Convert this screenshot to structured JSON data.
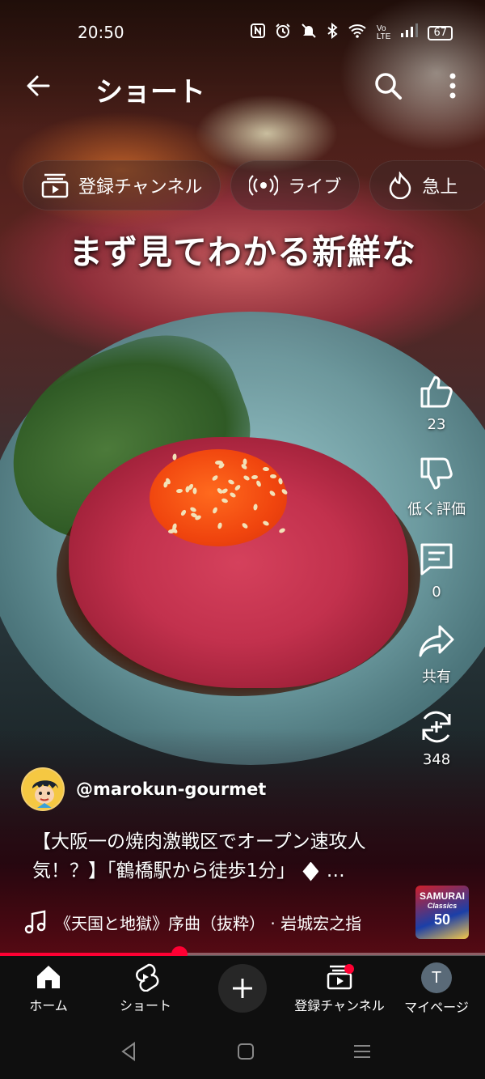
{
  "status_bar": {
    "time": "20:50",
    "battery": "67"
  },
  "app_bar": {
    "title": "ショート"
  },
  "chips": [
    {
      "label": "登録チャンネル",
      "icon": "subscriptions-icon"
    },
    {
      "label": "ライブ",
      "icon": "live-icon"
    },
    {
      "label": "急上",
      "icon": "trending-icon"
    }
  ],
  "video": {
    "overlay_caption": "まず見てわかる新鮮な"
  },
  "actions": {
    "like": {
      "label": "23"
    },
    "dislike": {
      "label": "低く評価"
    },
    "comment": {
      "label": "0"
    },
    "share": {
      "label": "共有"
    },
    "remix": {
      "label": "348"
    }
  },
  "channel": {
    "handle": "@marokun-gourmet"
  },
  "title": "【大阪一の焼肉激戦区でオープン速攻人気！？】「鶴橋駅から徒歩1分」",
  "music": {
    "text": "《天国と地獄》序曲（抜粋） · 岩城宏之指"
  },
  "album": {
    "line1": "SAMURAI",
    "line2": "Classics",
    "line3": "50"
  },
  "progress": {
    "fraction": 0.37
  },
  "bottom_nav": [
    {
      "label": "ホーム",
      "icon": "home-icon"
    },
    {
      "label": "ショート",
      "icon": "shorts-icon"
    },
    {
      "label": "",
      "icon": "create-icon"
    },
    {
      "label": "登録チャンネル",
      "icon": "subscriptions-icon"
    },
    {
      "label": "マイページ",
      "icon": "avatar-icon",
      "initial": "T"
    }
  ],
  "colors": {
    "accent": "#ff0033",
    "nav_bg": "#0f0f0f"
  }
}
